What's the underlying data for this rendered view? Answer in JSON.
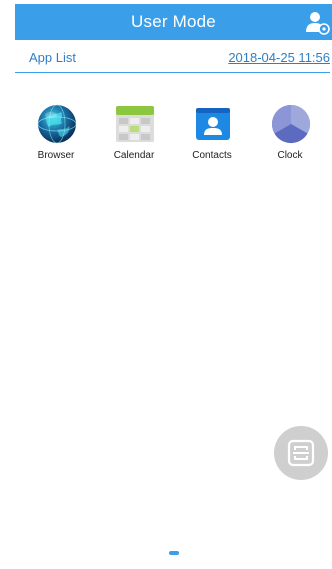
{
  "header": {
    "title": "User Mode",
    "user_switch_icon": "user-switch-icon"
  },
  "subbar": {
    "label": "App List",
    "datetime": "2018-04-25 11:56"
  },
  "apps": [
    {
      "label": "Browser",
      "icon": "browser-icon"
    },
    {
      "label": "Calendar",
      "icon": "calendar-icon"
    },
    {
      "label": "Contacts",
      "icon": "contacts-icon"
    },
    {
      "label": "Clock",
      "icon": "clock-icon"
    }
  ],
  "fab": {
    "icon": "scan-icon"
  },
  "colors": {
    "accent": "#3a9ee8",
    "link": "#2f7fc6",
    "fab_background": "#cfcfcf"
  },
  "pager": {
    "current_page": 1
  }
}
